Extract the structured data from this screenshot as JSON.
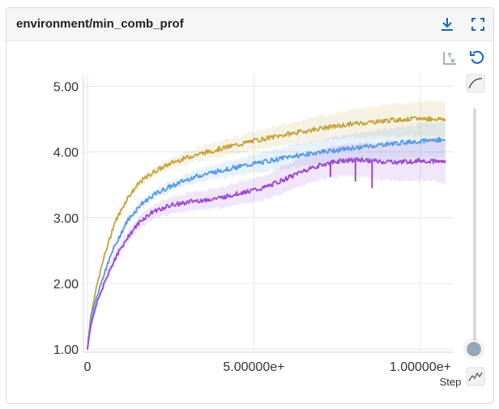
{
  "card": {
    "title": "environment/min_comb_prof",
    "download_icon": "download-icon",
    "fullscreen_icon": "fullscreen-icon",
    "y_axis_toggle_icon": "y-axis-scale-icon",
    "reset_icon": "reset-zoom-icon",
    "smoothing_icon": "smoothing-curve-icon",
    "raw_icon": "raw-line-icon"
  },
  "colors": {
    "gold": "#c2a33c",
    "blue": "#5599e6",
    "purple": "#9a47d1",
    "slider_knob": "#95a8b7",
    "accent": "#1565c0"
  },
  "chart_data": {
    "type": "line",
    "title": "environment/min_comb_prof",
    "xlabel": "Step",
    "ylabel": "",
    "xlim": [
      -12000,
      1100000
    ],
    "ylim": [
      0.95,
      5.18
    ],
    "x_ticks": [
      0,
      500000,
      1000000
    ],
    "x_tick_labels": [
      "0",
      "5.00000e+",
      "1.00000e+"
    ],
    "y_ticks": [
      1,
      2,
      3,
      4,
      5
    ],
    "y_tick_labels": [
      "1.00",
      "2.00",
      "3.00",
      "4.00",
      "5.00"
    ],
    "grid": true,
    "legend": "none",
    "series": [
      {
        "color": "#c2a33c",
        "x": [
          0,
          10000,
          25000,
          50000,
          80000,
          120000,
          160000,
          200000,
          260000,
          320000,
          400000,
          500000,
          600000,
          700000,
          800000,
          900000,
          1000000,
          1075000
        ],
        "y": [
          1.0,
          1.5,
          1.9,
          2.4,
          2.9,
          3.3,
          3.55,
          3.7,
          3.85,
          3.95,
          4.05,
          4.17,
          4.27,
          4.36,
          4.43,
          4.48,
          4.51,
          4.5
        ]
      },
      {
        "color": "#5599e6",
        "x": [
          0,
          10000,
          25000,
          50000,
          80000,
          120000,
          160000,
          200000,
          260000,
          320000,
          400000,
          500000,
          600000,
          700000,
          800000,
          900000,
          1000000,
          1075000
        ],
        "y": [
          1.0,
          1.45,
          1.75,
          2.15,
          2.55,
          2.95,
          3.2,
          3.35,
          3.5,
          3.62,
          3.72,
          3.82,
          3.92,
          4.0,
          4.06,
          4.12,
          4.17,
          4.19
        ]
      },
      {
        "color": "#9a47d1",
        "x": [
          0,
          10000,
          25000,
          50000,
          80000,
          120000,
          160000,
          200000,
          260000,
          320000,
          400000,
          460000,
          530000,
          600000,
          650000,
          700000,
          760000,
          820000,
          880000,
          940000,
          1000000,
          1075000
        ],
        "y": [
          1.0,
          1.35,
          1.65,
          2.0,
          2.35,
          2.7,
          2.95,
          3.1,
          3.2,
          3.25,
          3.3,
          3.38,
          3.45,
          3.6,
          3.72,
          3.8,
          3.87,
          3.88,
          3.85,
          3.85,
          3.87,
          3.85
        ]
      }
    ]
  }
}
